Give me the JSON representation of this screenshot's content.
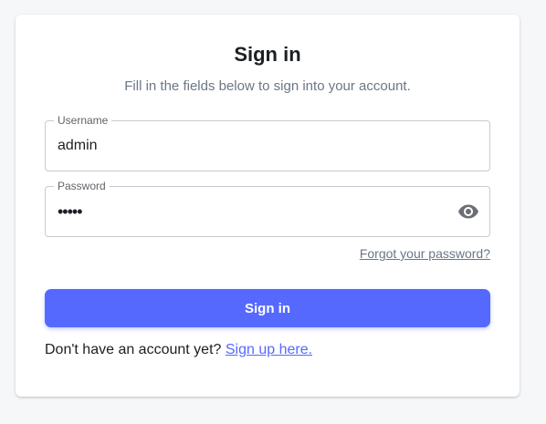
{
  "header": {
    "title": "Sign in",
    "subtitle": "Fill in the fields below to sign into your account."
  },
  "form": {
    "username": {
      "label": "Username",
      "value": "admin"
    },
    "password": {
      "label": "Password",
      "masked_value": "•••••",
      "visibility_icon": "eye-icon"
    },
    "forgot_password_label": "Forgot your password?",
    "submit_label": "Sign in"
  },
  "footer": {
    "prompt": "Don't have an account yet?",
    "signup_label": "Sign up here."
  },
  "colors": {
    "accent": "#5569ff",
    "title": "#1c1f24",
    "muted": "#6b7785",
    "border": "#c7cbd1"
  }
}
